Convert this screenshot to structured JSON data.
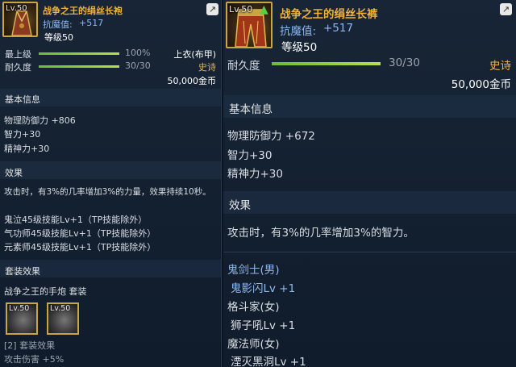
{
  "left": {
    "item_level_badge": "Lv.50",
    "name": "战争之王的绢丝长袍",
    "resist_label": "抗魔值:",
    "resist_value": "+517",
    "level_text": "等级50",
    "top_level_label": "最上级",
    "top_level_value": "100%",
    "durability_label": "耐久度",
    "durability_value": "30/30",
    "slot_type": "上衣(布甲)",
    "rarity": "史诗",
    "price": "50,000金币",
    "basic_info_title": "基本信息",
    "stats": [
      "物理防御力 +806",
      "智力+30",
      "精神力+30"
    ],
    "effect_title": "效果",
    "effect_text": "攻击时，有3%的几率增加3%的力量，效果持续10秒。",
    "skills": [
      "鬼泣45级技能Lv+1（TP技能除外）",
      "气功师45级技能Lv+1（TP技能除外）",
      "元素师45级技能Lv+1（TP技能除外）"
    ],
    "set_title": "套装效果",
    "set_name": "战争之王的手炮 套装",
    "set_icons": [
      "Lv.50",
      "Lv.50"
    ],
    "set_bonus_count": "[2] 套装效果",
    "set_bonus_stat": "攻击伤害 +5%"
  },
  "right": {
    "item_level_badge": "Lv.50",
    "name": "战争之王的绢丝长裤",
    "resist_label": "抗魔值:",
    "resist_value": "+517",
    "level_text": "等级50",
    "durability_label": "耐久度",
    "durability_value": "30/30",
    "rarity": "史诗",
    "price": "50,000金币",
    "basic_info_title": "基本信息",
    "stats": [
      "物理防御力 +672",
      "智力+30",
      "精神力+30"
    ],
    "effect_title": "效果",
    "effect_text": "攻击时，有3%的几率增加3%的智力。",
    "class_skills": [
      {
        "class": "鬼剑士(男)",
        "skill": "鬼影闪Lv +1"
      },
      {
        "class": "格斗家(女)",
        "skill": "狮子吼Lv +1"
      },
      {
        "class": "魔法师(女)",
        "skill": "湮灭黑洞Lv +1"
      }
    ]
  },
  "progress": {
    "left_top_level": 1.0,
    "left_durability": 1.0,
    "right_durability": 1.0
  },
  "colors": {
    "name": "#f0b23a",
    "rarity": "#f0b23a",
    "resist": "#8db8f0",
    "bar_fill": "#8fcf42",
    "frame": "#c9a640"
  },
  "icons": {
    "share": "share-icon",
    "upgrade_arrow": "up-arrow-icon"
  }
}
